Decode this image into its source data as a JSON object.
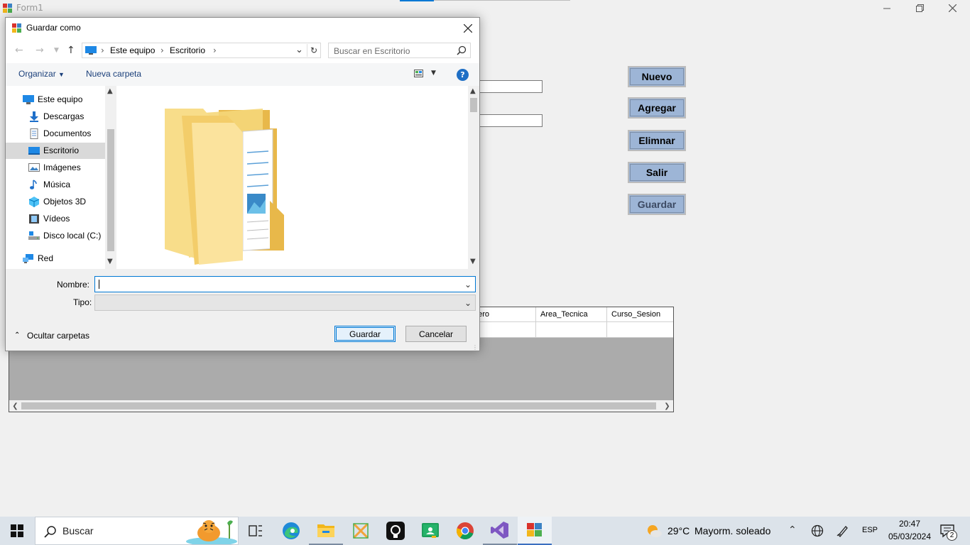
{
  "form": {
    "title": "Form1",
    "buttons": {
      "nuevo": "Nuevo",
      "agregar": "Agregar",
      "eliminar": "Elimnar",
      "salir": "Salir",
      "guardar": "Guardar"
    },
    "grid": {
      "columns": [
        "nero",
        "Area_Tecnica",
        "Curso_Sesion"
      ]
    }
  },
  "dialog": {
    "title": "Guardar como",
    "address": [
      "Este equipo",
      "Escritorio"
    ],
    "search_placeholder": "Buscar en Escritorio",
    "organize": "Organizar",
    "new_folder": "Nueva carpeta",
    "help": "?",
    "nav_items": [
      {
        "label": "Este equipo",
        "icon": "computer-icon"
      },
      {
        "label": "Descargas",
        "icon": "download-icon"
      },
      {
        "label": "Documentos",
        "icon": "documents-icon"
      },
      {
        "label": "Escritorio",
        "icon": "desktop-icon"
      },
      {
        "label": "Imágenes",
        "icon": "pictures-icon"
      },
      {
        "label": "Música",
        "icon": "music-icon"
      },
      {
        "label": "Objetos 3D",
        "icon": "3d-objects-icon"
      },
      {
        "label": "Vídeos",
        "icon": "videos-icon"
      },
      {
        "label": "Disco local (C:)",
        "icon": "drive-icon"
      },
      {
        "label": "Red",
        "icon": "network-icon"
      }
    ],
    "selected_nav": "Escritorio",
    "name_label": "Nombre:",
    "type_label": "Tipo:",
    "name_value": "",
    "hide_folders": "Ocultar carpetas",
    "save_button": "Guardar",
    "cancel_button": "Cancelar"
  },
  "taskbar": {
    "search_label": "Buscar",
    "weather_temp": "29°C",
    "weather_desc": "Mayorm. soleado",
    "language": "ESP",
    "time": "20:47",
    "date": "05/03/2024",
    "notifications": "2"
  }
}
